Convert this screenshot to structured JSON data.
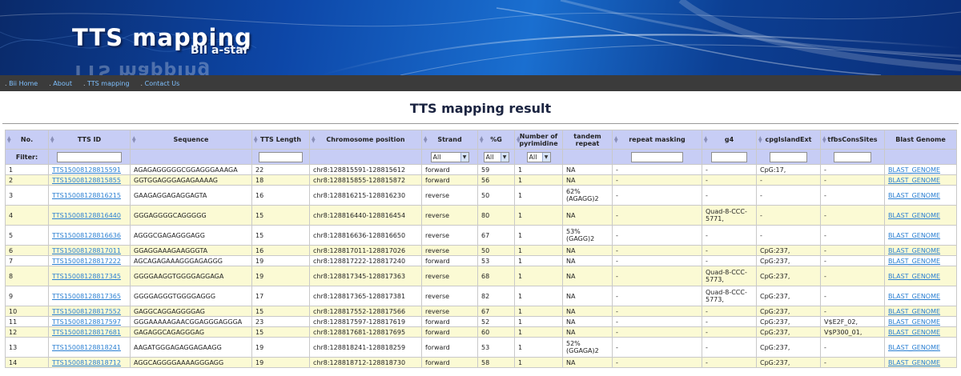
{
  "banner": {
    "title": "TTS mapping",
    "subtitle": "BII a-star",
    "reflection": "TTS mapping"
  },
  "nav": [
    "Bii Home",
    "About",
    "TTS mapping",
    "Contact Us"
  ],
  "page_title": "TTS mapping result",
  "table": {
    "columns": [
      "No.",
      "TTS ID",
      "Sequence",
      "TTS Length",
      "Chromosome position",
      "Strand",
      "%G",
      "Number of pyrimidine",
      "tandem repeat",
      "repeat masking",
      "g4",
      "cpgIslandExt",
      "tfbsConsSites",
      "Blast Genome"
    ],
    "filter_label": "Filter:",
    "filter_select_value": "All",
    "rows": [
      {
        "no": "1",
        "id": "TTS15008128815591",
        "seq": "AGAGAGGGGGCGGAGGGAAAGA",
        "len": "22",
        "pos": "chr8:128815591-128815612",
        "strand": "forward",
        "g": "59",
        "pyr": "1",
        "tandem": "NA",
        "rmask": "-",
        "g4": "-",
        "cpg": "CpG:17,",
        "tfbs": "-",
        "blast": "BLAST_GENOME"
      },
      {
        "no": "2",
        "id": "TTS15008128815855",
        "seq": "GGTGGAGGGAGAGAAAAG",
        "len": "18",
        "pos": "chr8:128815855-128815872",
        "strand": "forward",
        "g": "56",
        "pyr": "1",
        "tandem": "NA",
        "rmask": "-",
        "g4": "-",
        "cpg": "-",
        "tfbs": "-",
        "blast": "BLAST_GENOME"
      },
      {
        "no": "3",
        "id": "TTS15008128816215",
        "seq": "GAAGAGGAGAGGAGTA",
        "len": "16",
        "pos": "chr8:128816215-128816230",
        "strand": "reverse",
        "g": "50",
        "pyr": "1",
        "tandem": "62% (AGAGG)2",
        "rmask": "-",
        "g4": "-",
        "cpg": "-",
        "tfbs": "-",
        "blast": "BLAST_GENOME"
      },
      {
        "no": "4",
        "id": "TTS15008128816440",
        "seq": "GGGAGGGGCAGGGGG",
        "len": "15",
        "pos": "chr8:128816440-128816454",
        "strand": "reverse",
        "g": "80",
        "pyr": "1",
        "tandem": "NA",
        "rmask": "-",
        "g4": "Quad-8-CCC-5771,",
        "cpg": "-",
        "tfbs": "-",
        "blast": "BLAST_GENOME"
      },
      {
        "no": "5",
        "id": "TTS15008128816636",
        "seq": "AGGGCGAGAGGGAGG",
        "len": "15",
        "pos": "chr8:128816636-128816650",
        "strand": "reverse",
        "g": "67",
        "pyr": "1",
        "tandem": "53% (GAGG)2",
        "rmask": "-",
        "g4": "-",
        "cpg": "-",
        "tfbs": "-",
        "blast": "BLAST_GENOME"
      },
      {
        "no": "6",
        "id": "TTS15008128817011",
        "seq": "GGAGGAAAGAAGGGTA",
        "len": "16",
        "pos": "chr8:128817011-128817026",
        "strand": "reverse",
        "g": "50",
        "pyr": "1",
        "tandem": "NA",
        "rmask": "-",
        "g4": "-",
        "cpg": "CpG:237,",
        "tfbs": "-",
        "blast": "BLAST_GENOME"
      },
      {
        "no": "7",
        "id": "TTS15008128817222",
        "seq": "AGCAGAGAAAGGGAGAGGG",
        "len": "19",
        "pos": "chr8:128817222-128817240",
        "strand": "forward",
        "g": "53",
        "pyr": "1",
        "tandem": "NA",
        "rmask": "-",
        "g4": "-",
        "cpg": "CpG:237,",
        "tfbs": "-",
        "blast": "BLAST_GENOME"
      },
      {
        "no": "8",
        "id": "TTS15008128817345",
        "seq": "GGGGAAGGTGGGGAGGAGA",
        "len": "19",
        "pos": "chr8:128817345-128817363",
        "strand": "reverse",
        "g": "68",
        "pyr": "1",
        "tandem": "NA",
        "rmask": "-",
        "g4": "Quad-8-CCC-5773,",
        "cpg": "CpG:237,",
        "tfbs": "-",
        "blast": "BLAST_GENOME"
      },
      {
        "no": "9",
        "id": "TTS15008128817365",
        "seq": "GGGGAGGGTGGGGAGGG",
        "len": "17",
        "pos": "chr8:128817365-128817381",
        "strand": "reverse",
        "g": "82",
        "pyr": "1",
        "tandem": "NA",
        "rmask": "-",
        "g4": "Quad-8-CCC-5773,",
        "cpg": "CpG:237,",
        "tfbs": "-",
        "blast": "BLAST_GENOME"
      },
      {
        "no": "10",
        "id": "TTS15008128817552",
        "seq": "GAGGCAGGAGGGGAG",
        "len": "15",
        "pos": "chr8:128817552-128817566",
        "strand": "reverse",
        "g": "67",
        "pyr": "1",
        "tandem": "NA",
        "rmask": "-",
        "g4": "-",
        "cpg": "CpG:237,",
        "tfbs": "-",
        "blast": "BLAST_GENOME"
      },
      {
        "no": "11",
        "id": "TTS15008128817597",
        "seq": "GGGAAAAAGAACGGAGGGAGGGA",
        "len": "23",
        "pos": "chr8:128817597-128817619",
        "strand": "forward",
        "g": "52",
        "pyr": "1",
        "tandem": "NA",
        "rmask": "-",
        "g4": "-",
        "cpg": "CpG:237,",
        "tfbs": "V$E2F_02,",
        "blast": "BLAST_GENOME"
      },
      {
        "no": "12",
        "id": "TTS15008128817681",
        "seq": "GAGAGGCAGAGGGAG",
        "len": "15",
        "pos": "chr8:128817681-128817695",
        "strand": "forward",
        "g": "60",
        "pyr": "1",
        "tandem": "NA",
        "rmask": "-",
        "g4": "-",
        "cpg": "CpG:237,",
        "tfbs": "V$P300_01,",
        "blast": "BLAST_GENOME"
      },
      {
        "no": "13",
        "id": "TTS15008128818241",
        "seq": "AAGATGGGAGAGGAGAAGG",
        "len": "19",
        "pos": "chr8:128818241-128818259",
        "strand": "forward",
        "g": "53",
        "pyr": "1",
        "tandem": "52% (GGAGA)2",
        "rmask": "-",
        "g4": "-",
        "cpg": "CpG:237,",
        "tfbs": "-",
        "blast": "BLAST_GENOME"
      },
      {
        "no": "14",
        "id": "TTS15008128818712",
        "seq": "AGGCAGGGGAAAAGGGAGG",
        "len": "19",
        "pos": "chr8:128818712-128818730",
        "strand": "forward",
        "g": "58",
        "pyr": "1",
        "tandem": "NA",
        "rmask": "-",
        "g4": "-",
        "cpg": "CpG:237,",
        "tfbs": "-",
        "blast": "BLAST_GENOME"
      }
    ]
  }
}
